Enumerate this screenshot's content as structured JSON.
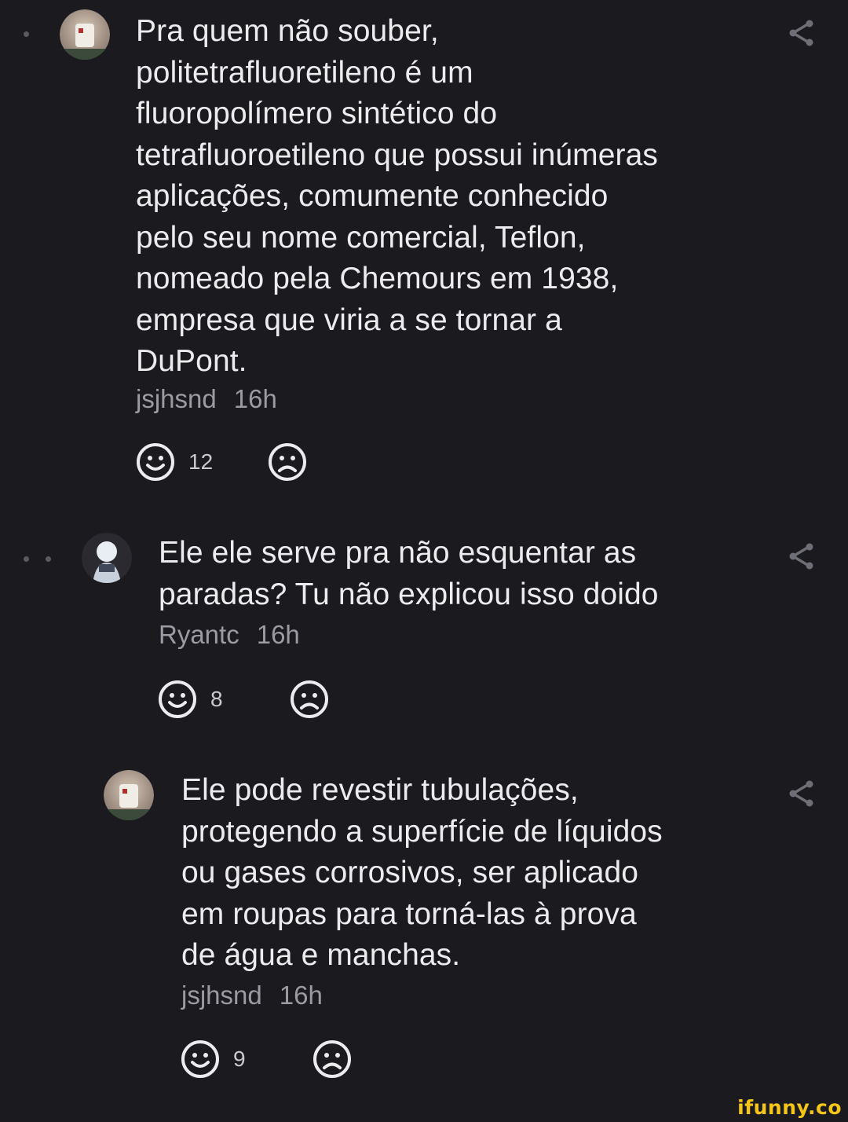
{
  "comments": [
    {
      "text": "Pra quem não souber,\npolitetrafluoretileno é um\nfluoropolímero sintético do\ntetrafluoroetileno que possui inúmeras\naplicações, comumente conhecido\npelo seu nome comercial, Teflon,\nnomeado pela Chemours em 1938,\nempresa que viria a se tornar a\nDuPont.",
      "username": "jsjhsnd",
      "time": "16h",
      "likes": "12",
      "avatar_icon": "avatar-icon"
    },
    {
      "text": "Ele ele serve pra não esquentar as\nparadas? Tu não explicou isso doido",
      "username": "Ryantc",
      "time": "16h",
      "likes": "8",
      "avatar_icon": "avatar-icon"
    },
    {
      "text": "Ele pode revestir tubulações,\nprotegendo a superfície de líquidos\nou gases corrosivos, ser aplicado\nem roupas para torná-las à prova\nde água e manchas.",
      "username": "jsjhsnd",
      "time": "16h",
      "likes": "9",
      "avatar_icon": "avatar-icon"
    }
  ],
  "icons": {
    "share": "share-icon",
    "smile": "smile-icon",
    "frown": "frown-icon"
  },
  "watermark": "ifunny.co",
  "colors": {
    "background": "#1b1b1f",
    "text": "#ececef",
    "meta": "#9b9ba3",
    "watermark": "#f5c518"
  }
}
